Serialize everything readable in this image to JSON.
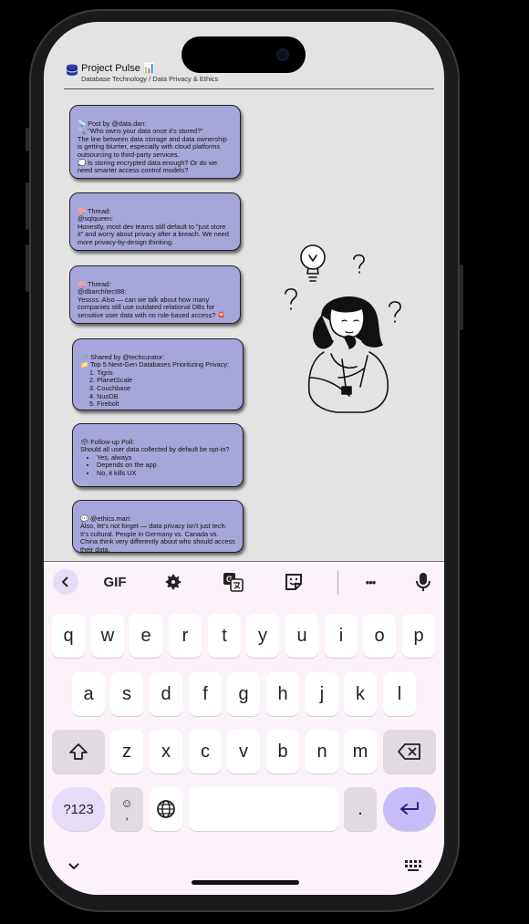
{
  "header": {
    "title": "Project Pulse 📊",
    "breadcrumb": "Database Technology / Data Privacy & Ethics"
  },
  "posts": [
    {
      "text": "📡 Post by @data.dan:\n🔍 \"Who owns your data once it's stored?\"\n The line between data storage and data ownership is getting blurrier, especially with cloud platforms outsourcing to third-party services.\n💭 Is storing encrypted data enough? Or do we need smarter access control models?"
    },
    {
      "text": "🧠 Thread:\n@sqlqueen:\n Honestly, most dev teams still default to \"just store it\" and worry about privacy after a breach. We need more privacy-by-design thinking."
    },
    {
      "text": "🧠 Thread:\n@dbarchitect88:\n Yessss. Also — can we talk about how many companies still use outdated relational DBs for sensitive user data with no role-based access? 🚨"
    },
    {
      "text": "🔗 Shared by @techcurator:\n📁 Top 5 Next-Gen Databases Prioritizing Privacy:",
      "items": [
        "Tigris",
        "PlanetScale",
        "Couchbase",
        "NuoDB",
        "Firebolt"
      ]
    },
    {
      "text": "🗳 Follow-up Poll:\n Should all user data collected by default be opt-in?",
      "options": [
        "Yes, always",
        "Depends on the app",
        "No, it kills UX"
      ]
    },
    {
      "text": "💬 @ethics.mari:\n Also, let's not forget — data privacy isn't just tech. It's cultural. People in Germany vs. Canada vs. China think very differently about who should access their data."
    }
  ],
  "keyboard": {
    "toolbar": {
      "gif": "GIF",
      "more": "•••"
    },
    "row1": [
      "q",
      "w",
      "e",
      "r",
      "t",
      "y",
      "u",
      "i",
      "o",
      "p"
    ],
    "row2": [
      "a",
      "s",
      "d",
      "f",
      "g",
      "h",
      "j",
      "k",
      "l"
    ],
    "row3": [
      "z",
      "x",
      "c",
      "v",
      "b",
      "n",
      "m"
    ],
    "numbers_label": "?123",
    "emoji_comma": "☺\n,",
    "period": ".",
    "colors": {
      "accent": "#c6bdf8",
      "post_bg": "#a7a6da",
      "kb_bg": "#fbf2fa"
    }
  }
}
